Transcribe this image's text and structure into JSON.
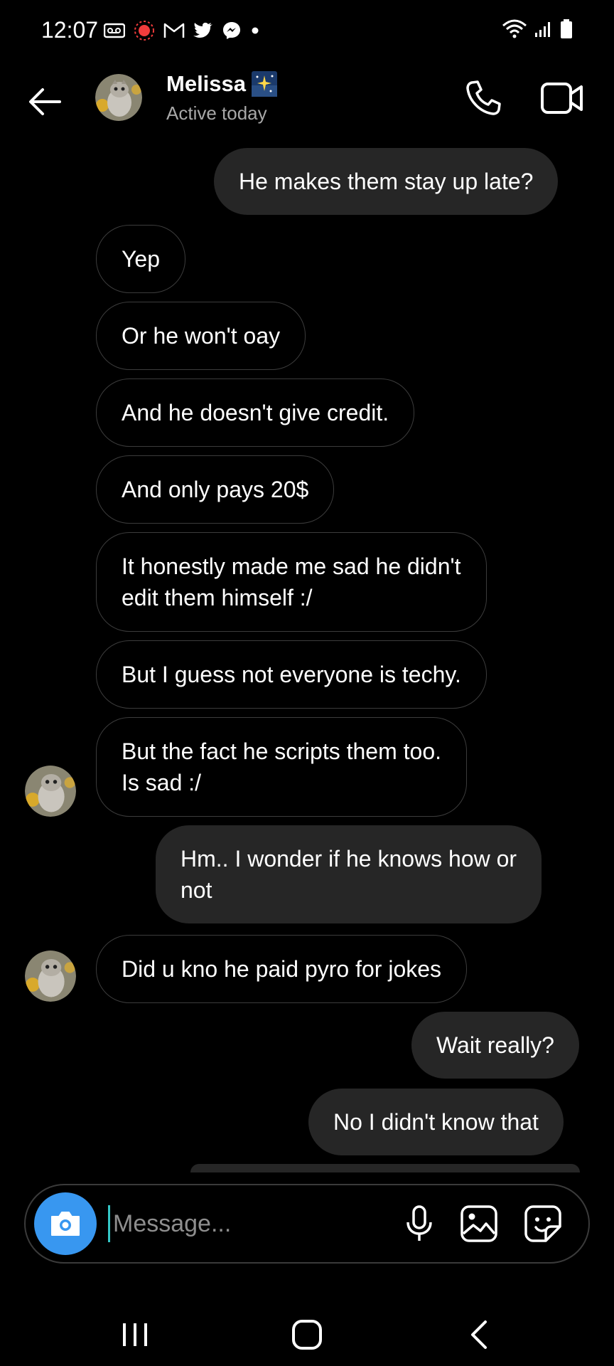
{
  "status_bar": {
    "time": "12:07"
  },
  "header": {
    "contact_name": "Melissa",
    "status": "Active today"
  },
  "messages": [
    {
      "side": "out",
      "text": "He makes them stay up late?"
    },
    {
      "side": "in",
      "text": "Yep"
    },
    {
      "side": "in",
      "text": "Or he won't oay"
    },
    {
      "side": "in",
      "text": "And he doesn't give credit."
    },
    {
      "side": "in",
      "text": "And only pays 20$"
    },
    {
      "side": "in",
      "line1": "It honestly made me sad he didn't",
      "line2": "edit them himself :/"
    },
    {
      "side": "in",
      "text": "But I guess not everyone is techy."
    },
    {
      "side": "in",
      "line1": "But the fact he scripts them too.",
      "line2": "Is sad :/"
    },
    {
      "side": "out",
      "line1": "Hm.. I wonder if he knows how or",
      "line2": "not"
    },
    {
      "side": "in",
      "text": "Did u kno he paid pyro for jokes"
    },
    {
      "side": "out",
      "text": "Wait really?"
    },
    {
      "side": "out",
      "text": "No I didn't know that"
    }
  ],
  "composer": {
    "placeholder": "Message..."
  },
  "colors": {
    "background": "#000000",
    "outgoing_bubble": "#262626",
    "incoming_border": "#3c3c3c",
    "camera_button": "#3897f0",
    "secondary_text": "#a8a8a8"
  },
  "icons": [
    "back-arrow-icon",
    "phone-icon",
    "video-camera-icon",
    "camera-icon",
    "microphone-icon",
    "gallery-icon",
    "sticker-icon",
    "wifi-icon",
    "signal-icon",
    "battery-icon"
  ]
}
